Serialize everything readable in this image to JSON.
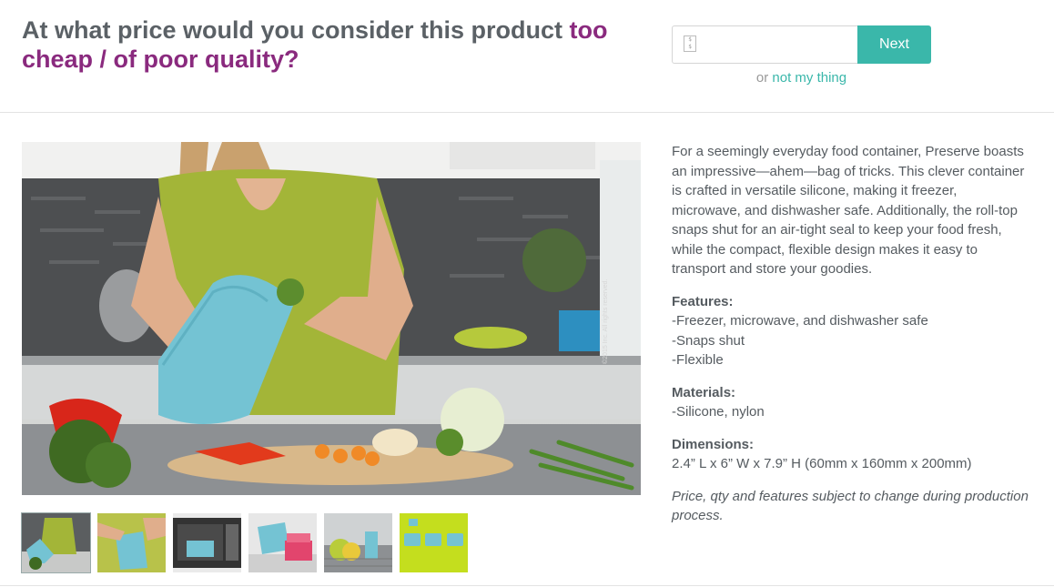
{
  "question": {
    "prefix": "At what price would you consider this product ",
    "highlight": "too cheap / of poor quality?"
  },
  "answer": {
    "input_value": "",
    "currency_icon": "currency-icon",
    "next_label": "Next",
    "or_text": "or",
    "skip_label": "not my thing"
  },
  "product": {
    "main_image": "woman-with-silicone-container-photo",
    "watermark": "©2015 Inc. All rights reserved.",
    "thumbnails": [
      {
        "name": "thumb-woman-kitchen"
      },
      {
        "name": "thumb-container-hands"
      },
      {
        "name": "thumb-microwave"
      },
      {
        "name": "thumb-pink-containers"
      },
      {
        "name": "thumb-dishwasher"
      },
      {
        "name": "thumb-three-containers"
      }
    ],
    "description": "For a seemingly everyday food container, Preserve boasts an impressive—ahem—bag of tricks. This clever container is crafted in versatile silicone, making it freezer, microwave, and dishwasher safe. Additionally, the roll-top snaps shut for an air-tight seal to keep your food fresh, while the compact, flexible design makes it easy to transport and store your goodies.",
    "features_title": "Features:",
    "features": [
      "-Freezer, microwave, and dishwasher safe",
      "-Snaps shut",
      "-Flexible"
    ],
    "materials_title": "Materials:",
    "materials": [
      "-Silicone, nylon"
    ],
    "dimensions_title": "Dimensions:",
    "dimensions": "2.4” L x 6” W x 7.9” H (60mm x 160mm x 200mm)",
    "note": "Price, qty and features subject to change during production process."
  },
  "colors": {
    "accent": "#3ab7aa",
    "question_highlight": "#8a2a7e",
    "text": "#555b60"
  }
}
